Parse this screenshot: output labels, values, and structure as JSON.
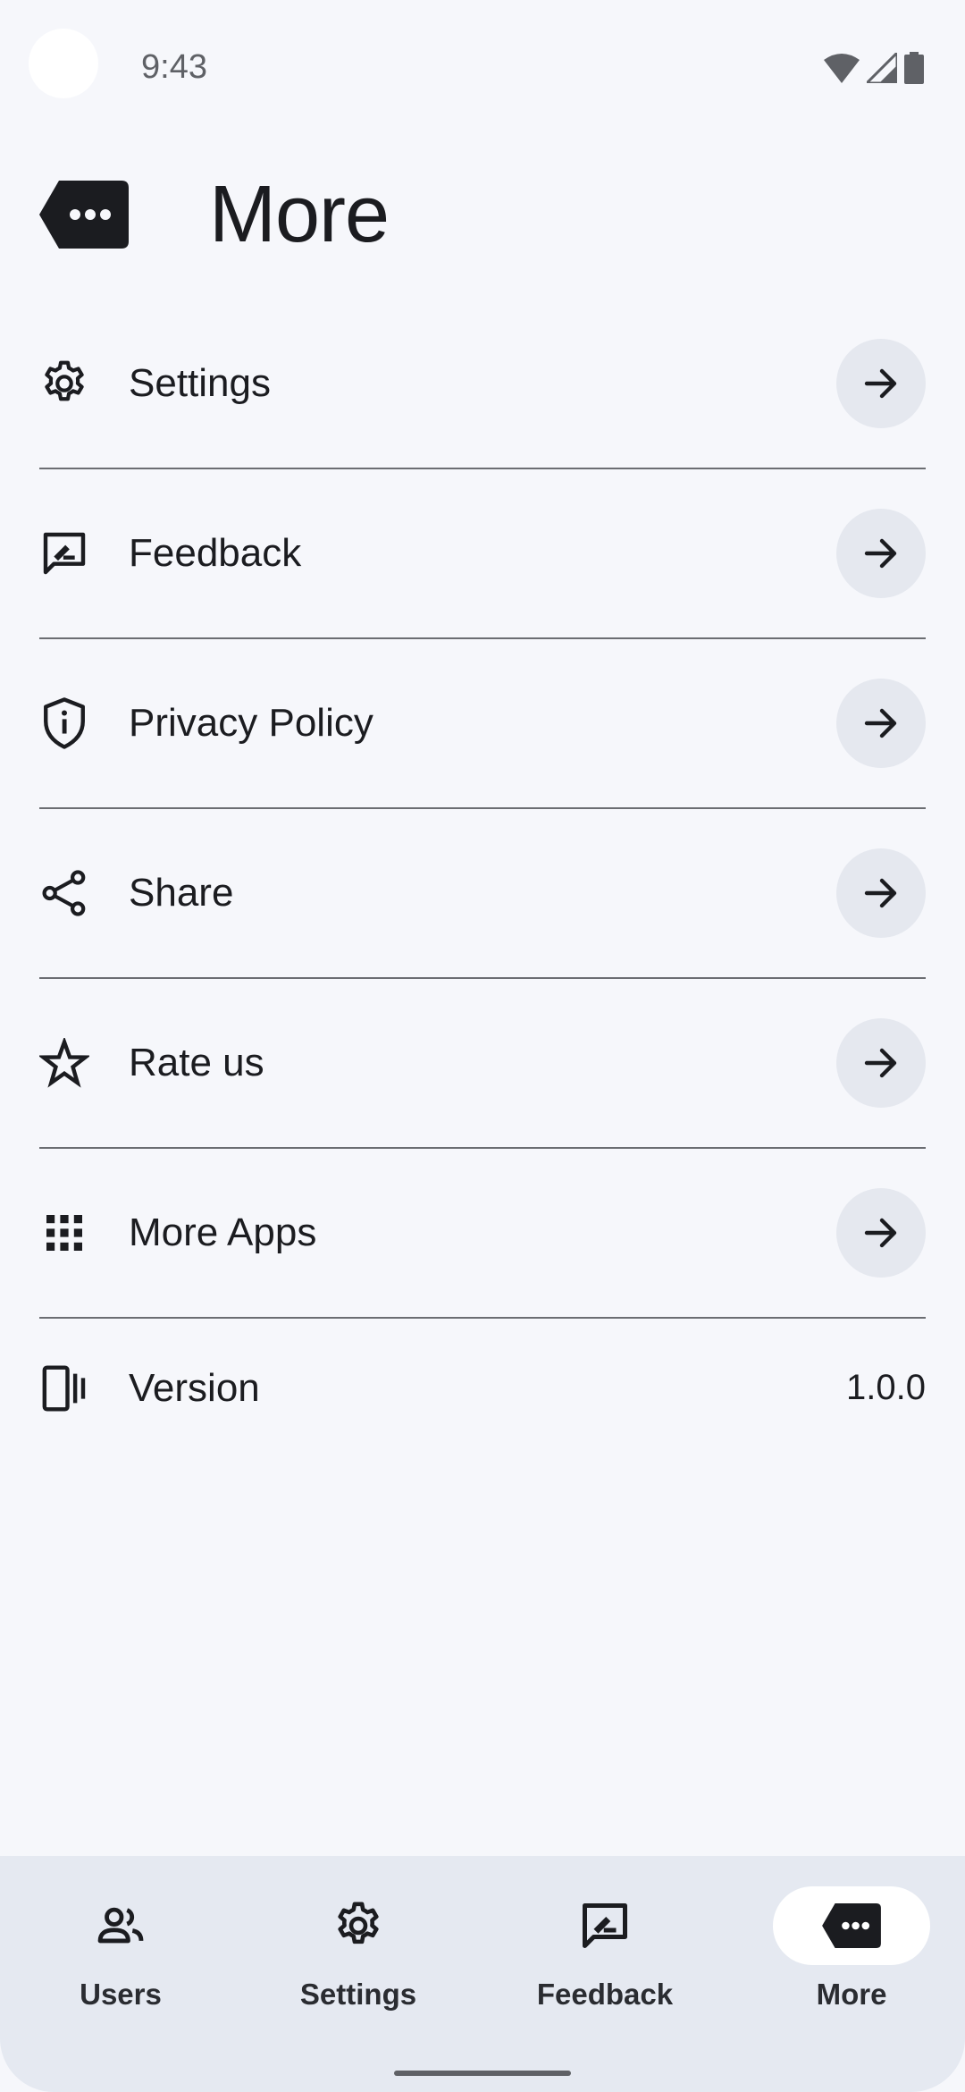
{
  "status_bar": {
    "time": "9:43",
    "icons": [
      "wifi-icon",
      "signal-icon",
      "battery-icon"
    ]
  },
  "header": {
    "title": "More",
    "icon": "more-label-icon"
  },
  "menu": {
    "items": [
      {
        "label": "Settings",
        "icon": "gear-icon"
      },
      {
        "label": "Feedback",
        "icon": "feedback-icon"
      },
      {
        "label": "Privacy Policy",
        "icon": "shield-info-icon"
      },
      {
        "label": "Share",
        "icon": "share-icon"
      },
      {
        "label": "Rate us",
        "icon": "star-icon"
      },
      {
        "label": "More Apps",
        "icon": "apps-grid-icon"
      }
    ],
    "version": {
      "label": "Version",
      "value": "1.0.0",
      "icon": "device-vibrate-icon"
    }
  },
  "bottom_nav": {
    "items": [
      {
        "label": "Users",
        "icon": "users-icon",
        "active": false
      },
      {
        "label": "Settings",
        "icon": "gear-icon",
        "active": false
      },
      {
        "label": "Feedback",
        "icon": "feedback-icon",
        "active": false
      },
      {
        "label": "More",
        "icon": "more-label-icon",
        "active": true
      }
    ]
  },
  "colors": {
    "background": "#f6f7fb",
    "nav_background": "#e5e9f1",
    "arrow_button": "#e5e8ef",
    "text": "#1b1c20",
    "divider": "#6b6d72"
  }
}
